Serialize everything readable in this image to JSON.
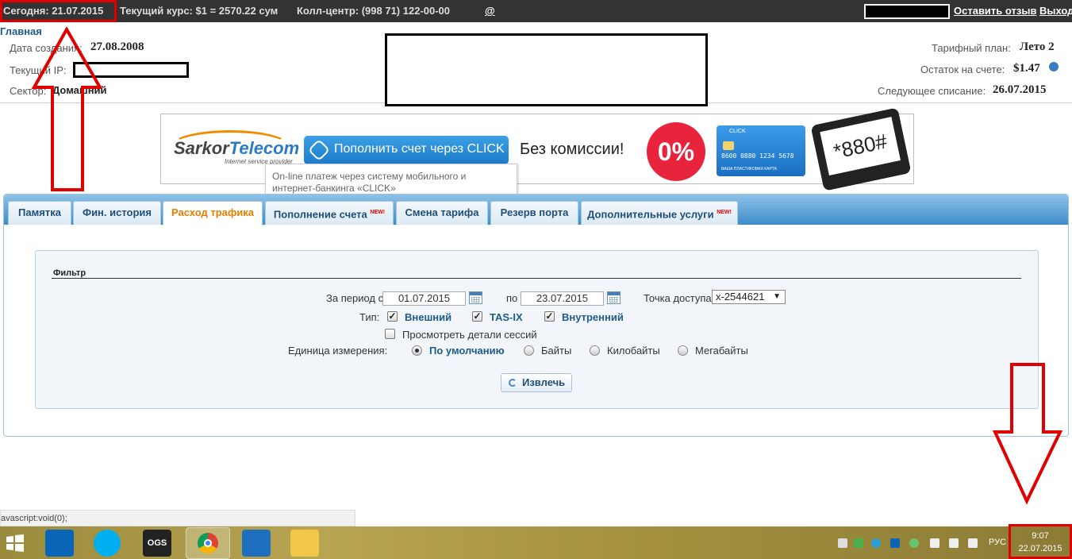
{
  "topbar": {
    "today": "Сегодня: 21.07.2015",
    "rate": "Текущий курс: $1 = 2570.22 сум",
    "callcenter": "Колл-центр: (998 71) 122-00-00",
    "at": "@",
    "feedback": "Оставить отзыв",
    "logout": "Выход"
  },
  "breadcrumb": "Главная",
  "account": {
    "created_label": "Дата создания:",
    "created_value": "27.08.2008",
    "ip_label": "Текущий IP:",
    "sector_label": "Сектор:",
    "sector_value": "Домашний",
    "plan_label": "Тарифный план:",
    "plan_value": "Лето 2",
    "balance_label": "Остаток на счете:",
    "balance_value": "$1.47",
    "next_label": "Следующее списание:",
    "next_value": "26.07.2015"
  },
  "banner": {
    "logo_main": "Sarkor",
    "logo_tel": "Telecom",
    "logo_sub": "Internet service provider",
    "click_label": "Пополнить счет через CLICK",
    "no_commission": "Без комиссии!",
    "percent": "0%",
    "card_brand": "CLICK",
    "card_number": "8600 0880 1234 5678",
    "card_caption": "ВАША ПЛАСТИКОВАЯ КАРТА",
    "phone_code": "*880#",
    "tooltip": "On-line платеж через систему мобильного и интернет-банкинга «CLICK»"
  },
  "tabs": [
    {
      "label": "Памятка",
      "new": ""
    },
    {
      "label": "Фин. история",
      "new": ""
    },
    {
      "label": "Расход трафика",
      "new": ""
    },
    {
      "label": "Пополнение счета",
      "new": "NEW!"
    },
    {
      "label": "Смена тарифа",
      "new": ""
    },
    {
      "label": "Резерв порта",
      "new": ""
    },
    {
      "label": "Дополнительные услуги",
      "new": "NEW!"
    }
  ],
  "filter": {
    "title": "Фильтр",
    "period_from_label": "За период с",
    "period_from": "01.07.2015",
    "period_to_label": "по",
    "period_to": "23.07.2015",
    "access_point_label": "Точка доступа",
    "access_point": "x-2544621",
    "type_label": "Тип:",
    "types": [
      "Внешний",
      "TAS-IX",
      "Внутренний"
    ],
    "session_details": "Просмотреть детали сессий",
    "unit_label": "Единица измерения:",
    "units": [
      "По умолчанию",
      "Байты",
      "Килобайты",
      "Мегабайты"
    ],
    "unit_selected": "По умолчанию",
    "extract_button": "Извлечь"
  },
  "statusbar": "avascript:void(0);",
  "taskbar": {
    "lang": "РУС",
    "time": "9:07",
    "date": "22.07.2015"
  },
  "colors": {
    "topbar": "#333333",
    "tab_active_text": "#e67e00",
    "link": "#1f5b8a",
    "annotation_red": "#e00000"
  }
}
